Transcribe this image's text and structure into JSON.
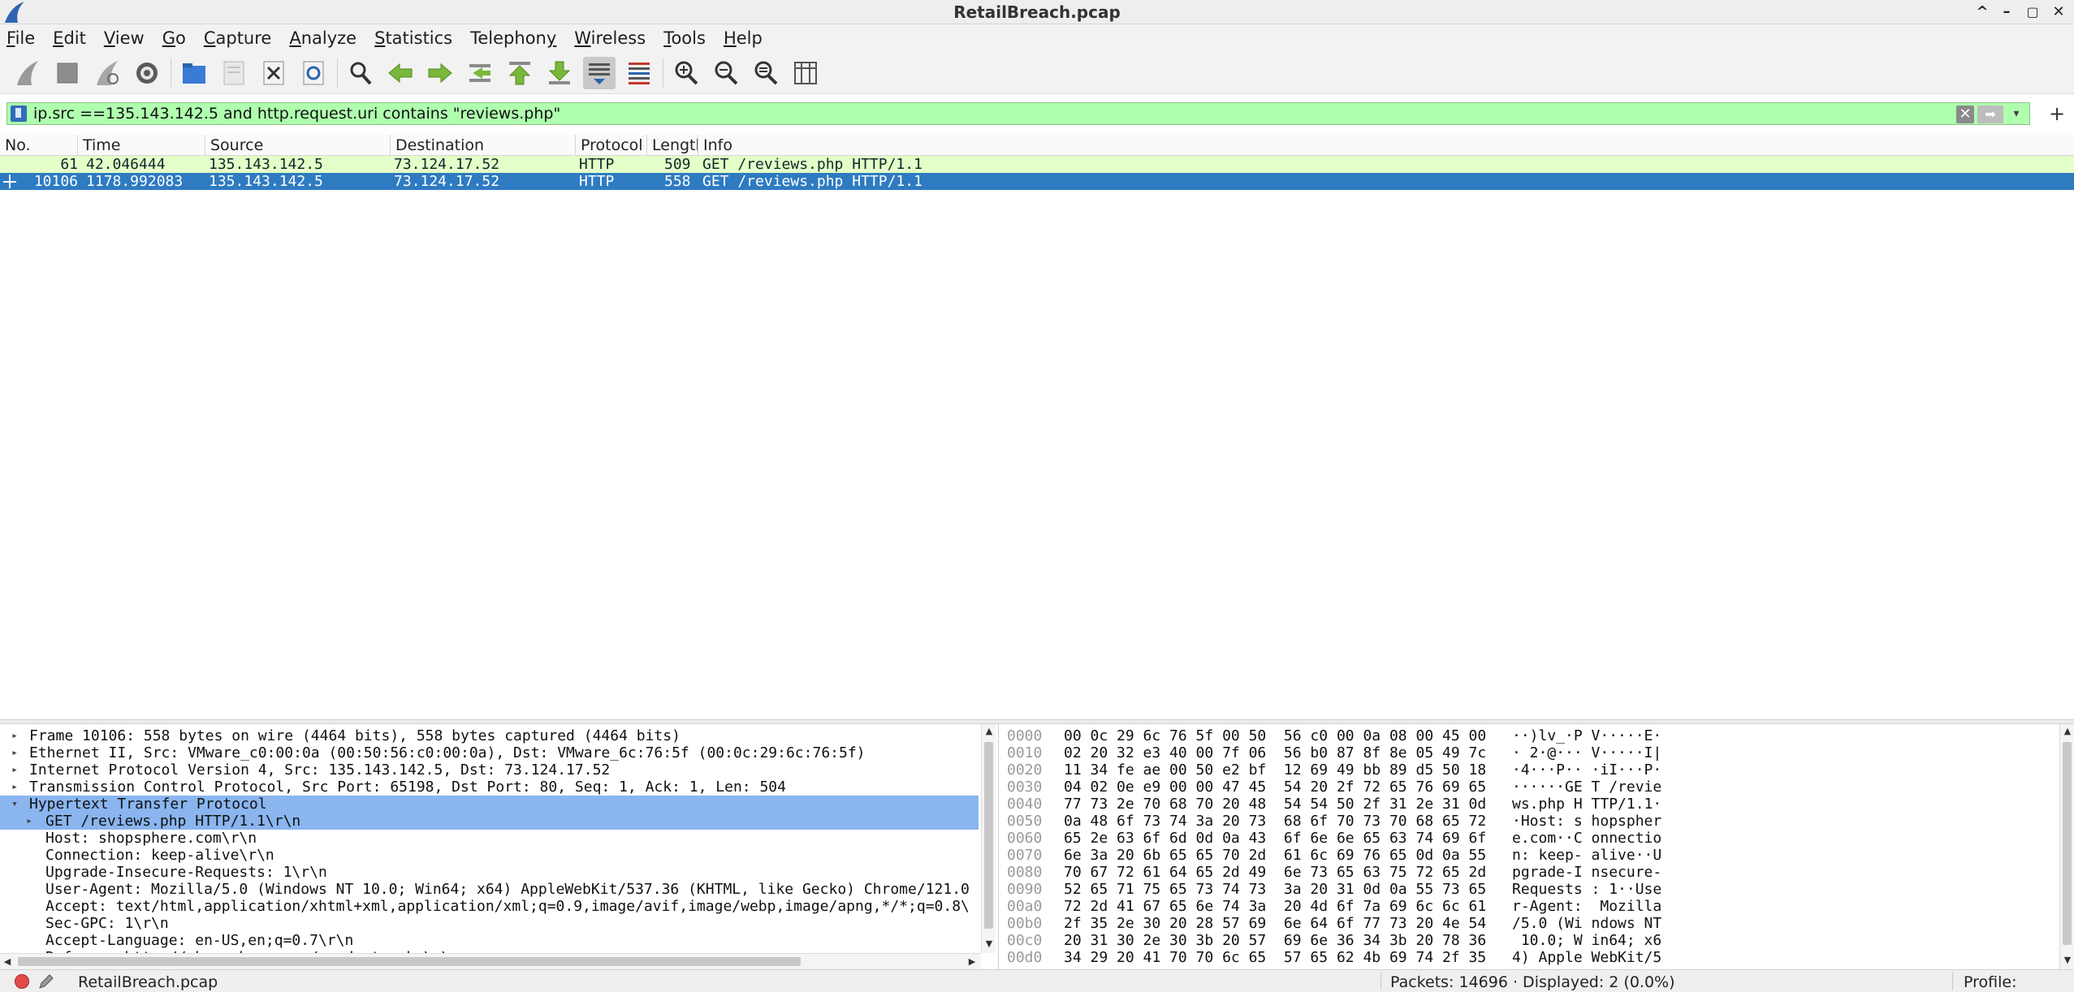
{
  "window": {
    "title": "RetailBreach.pcap",
    "controls": {
      "minimize": "–",
      "restore": "▢",
      "maximize": "^",
      "close": "✕"
    }
  },
  "menu": [
    {
      "label": "File",
      "key": "F",
      "rest": "ile"
    },
    {
      "label": "Edit",
      "key": "E",
      "rest": "dit"
    },
    {
      "label": "View",
      "key": "V",
      "rest": "iew"
    },
    {
      "label": "Go",
      "key": "G",
      "rest": "o"
    },
    {
      "label": "Capture",
      "key": "C",
      "rest": "apture"
    },
    {
      "label": "Analyze",
      "key": "A",
      "rest": "nalyze"
    },
    {
      "label": "Statistics",
      "key": "S",
      "rest": "tatistics"
    },
    {
      "label": "Telephony",
      "pre": "Telephon",
      "key": "y",
      "rest": ""
    },
    {
      "label": "Wireless",
      "key": "W",
      "rest": "ireless"
    },
    {
      "label": "Tools",
      "key": "T",
      "rest": "ools"
    },
    {
      "label": "Help",
      "key": "H",
      "rest": "elp"
    }
  ],
  "toolbar": {
    "icons": [
      "start-capture-icon",
      "stop-capture-icon",
      "restart-capture-icon",
      "capture-options-icon",
      "open-file-icon",
      "save-file-icon",
      "close-file-icon",
      "reload-file-icon",
      "find-packet-icon",
      "go-back-icon",
      "go-forward-icon",
      "go-to-packet-icon",
      "go-first-icon",
      "go-last-icon",
      "autoscroll-icon",
      "colorize-icon",
      "zoom-in-icon",
      "zoom-out-icon",
      "zoom-normal-icon",
      "resize-columns-icon"
    ]
  },
  "filter": {
    "value": "ip.src ==135.143.142.5 and http.request.uri contains \"reviews.php\"",
    "clear": "✕",
    "apply": "➡",
    "dropdown": "▾",
    "add": "+"
  },
  "packet_list": {
    "columns": [
      "No.",
      "Time",
      "Source",
      "Destination",
      "Protocol",
      "Length",
      "Info"
    ],
    "rows": [
      {
        "no": "61",
        "time": "42.046444",
        "source": "135.143.142.5",
        "destination": "73.124.17.52",
        "protocol": "HTTP",
        "length": "509",
        "info": "GET /reviews.php HTTP/1.1"
      },
      {
        "no": "10106",
        "time": "1178.992083",
        "source": "135.143.142.5",
        "destination": "73.124.17.52",
        "protocol": "HTTP",
        "length": "558",
        "info": "GET /reviews.php HTTP/1.1"
      }
    ]
  },
  "details": {
    "rows": [
      {
        "arrow": "▸",
        "indent": 0,
        "text": "Frame 10106: 558 bytes on wire (4464 bits), 558 bytes captured (4464 bits)"
      },
      {
        "arrow": "▸",
        "indent": 0,
        "text": "Ethernet II, Src: VMware_c0:00:0a (00:50:56:c0:00:0a), Dst: VMware_6c:76:5f (00:0c:29:6c:76:5f)"
      },
      {
        "arrow": "▸",
        "indent": 0,
        "text": "Internet Protocol Version 4, Src: 135.143.142.5, Dst: 73.124.17.52"
      },
      {
        "arrow": "▸",
        "indent": 0,
        "text": "Transmission Control Protocol, Src Port: 65198, Dst Port: 80, Seq: 1, Ack: 1, Len: 504"
      },
      {
        "arrow": "▾",
        "indent": 0,
        "text": "Hypertext Transfer Protocol",
        "selected": true
      },
      {
        "arrow": "▸",
        "indent": 1,
        "text": "GET /reviews.php HTTP/1.1\\r\\n",
        "selected": true
      },
      {
        "arrow": "",
        "indent": 1,
        "text": "Host: shopsphere.com\\r\\n"
      },
      {
        "arrow": "",
        "indent": 1,
        "text": "Connection: keep-alive\\r\\n"
      },
      {
        "arrow": "",
        "indent": 1,
        "text": "Upgrade-Insecure-Requests: 1\\r\\n"
      },
      {
        "arrow": "",
        "indent": 1,
        "text": "User-Agent: Mozilla/5.0 (Windows NT 10.0; Win64; x64) AppleWebKit/537.36 (KHTML, like Gecko) Chrome/121.0"
      },
      {
        "arrow": "",
        "indent": 1,
        "text": "Accept: text/html,application/xhtml+xml,application/xml;q=0.9,image/avif,image/webp,image/apng,*/*;q=0.8\\"
      },
      {
        "arrow": "",
        "indent": 1,
        "text": "Sec-GPC: 1\\r\\n"
      },
      {
        "arrow": "",
        "indent": 1,
        "text": "Accept-Language: en-US,en;q=0.7\\r\\n"
      },
      {
        "arrow": "",
        "indent": 1,
        "text": "Referer: http://shopsphere.com/products.php\\r\\n"
      }
    ]
  },
  "bytes": {
    "rows": [
      {
        "off": "0000",
        "hex": "00 0c 29 6c 76 5f 00 50  56 c0 00 0a 08 00 45 00",
        "asc": "··)lv_·P V·····E·"
      },
      {
        "off": "0010",
        "hex": "02 20 32 e3 40 00 7f 06  56 b0 87 8f 8e 05 49 7c",
        "asc": "· 2·@··· V·····I|"
      },
      {
        "off": "0020",
        "hex": "11 34 fe ae 00 50 e2 bf  12 69 49 bb 89 d5 50 18",
        "asc": "·4···P·· ·iI···P·"
      },
      {
        "off": "0030",
        "hex": "04 02 0e e9 00 00 47 45  54 20 2f 72 65 76 69 65",
        "asc": "······GE T /revie"
      },
      {
        "off": "0040",
        "hex": "77 73 2e 70 68 70 20 48  54 54 50 2f 31 2e 31 0d",
        "asc": "ws.php H TTP/1.1·"
      },
      {
        "off": "0050",
        "hex": "0a 48 6f 73 74 3a 20 73  68 6f 70 73 70 68 65 72",
        "asc": "·Host: s hopspher"
      },
      {
        "off": "0060",
        "hex": "65 2e 63 6f 6d 0d 0a 43  6f 6e 6e 65 63 74 69 6f",
        "asc": "e.com··C onnectio"
      },
      {
        "off": "0070",
        "hex": "6e 3a 20 6b 65 65 70 2d  61 6c 69 76 65 0d 0a 55",
        "asc": "n: keep- alive··U"
      },
      {
        "off": "0080",
        "hex": "70 67 72 61 64 65 2d 49  6e 73 65 63 75 72 65 2d",
        "asc": "pgrade-I nsecure-"
      },
      {
        "off": "0090",
        "hex": "52 65 71 75 65 73 74 73  3a 20 31 0d 0a 55 73 65",
        "asc": "Requests : 1··Use"
      },
      {
        "off": "00a0",
        "hex": "72 2d 41 67 65 6e 74 3a  20 4d 6f 7a 69 6c 6c 61",
        "asc": "r-Agent:  Mozilla"
      },
      {
        "off": "00b0",
        "hex": "2f 35 2e 30 20 28 57 69  6e 64 6f 77 73 20 4e 54",
        "asc": "/5.0 (Wi ndows NT"
      },
      {
        "off": "00c0",
        "hex": "20 31 30 2e 30 3b 20 57  69 6e 36 34 3b 20 78 36",
        "asc": " 10.0; W in64; x6"
      },
      {
        "off": "00d0",
        "hex": "34 29 20 41 70 70 6c 65  57 65 62 4b 69 74 2f 35",
        "asc": "4) Apple WebKit/5"
      }
    ]
  },
  "status": {
    "file": "RetailBreach.pcap",
    "packets": "Packets: 14696 · Displayed: 2 (0.0%)",
    "profile": "Profile: Default"
  },
  "colors": {
    "filter_bg": "#afffaf",
    "selected_row": "#2e7bc2",
    "http_row": "#e4ffc7",
    "detail_highlight": "#8ab5ef"
  }
}
